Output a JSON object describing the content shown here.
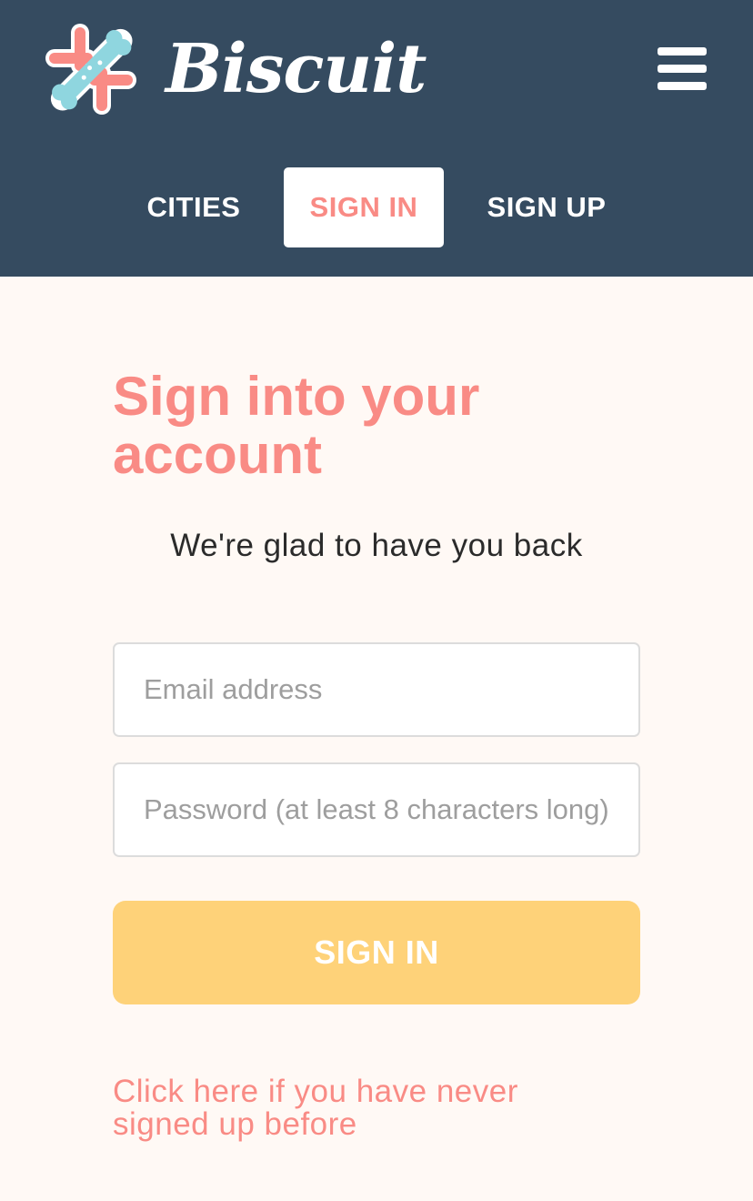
{
  "header": {
    "brand": "Biscuit",
    "logo_icon": "biscuit-bone-logo-icon",
    "menu_icon": "hamburger-menu-icon",
    "background_color": "#354b60"
  },
  "nav": {
    "items": [
      {
        "label": "CITIES",
        "active": false
      },
      {
        "label": "SIGN IN",
        "active": true
      },
      {
        "label": "SIGN UP",
        "active": false
      }
    ]
  },
  "main": {
    "title": "Sign into your account",
    "subtitle": "We're glad to have you back",
    "email_placeholder": "Email address",
    "password_placeholder": "Password (at least 8 characters long)",
    "submit_label": "SIGN IN",
    "signup_link": "Click here if you have never signed up before"
  },
  "colors": {
    "accent": "#f98b85",
    "button": "#fed279",
    "page_background": "#fff9f5"
  }
}
